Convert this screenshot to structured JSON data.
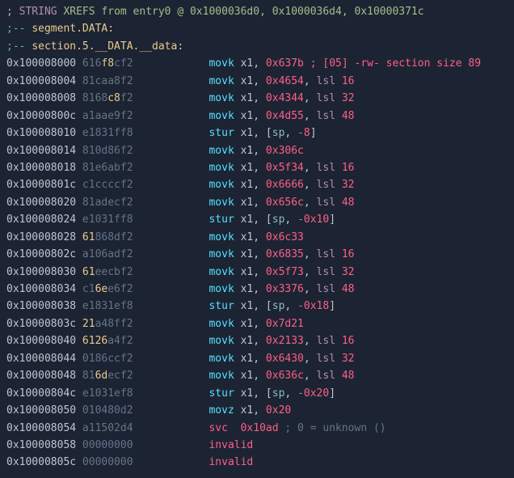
{
  "header": {
    "prefix": ";",
    "xrefs_kw": "STRING",
    "xrefs_rest": "XREFS from entry0 @ 0x1000036d0, 0x1000036d4, 0x10000371c",
    "seg_prefix": ";-- ",
    "seg": "segment.DATA:",
    "sec": "section.5.__DATA.__data:"
  },
  "col_widths": {
    "addr": 11,
    "hex": 8,
    "gap1": 12,
    "mnem": 5
  },
  "rows": [
    {
      "addr": "0x100008000",
      "hl": [
        3,
        4
      ],
      "hex": "616f8cf2",
      "mnem": "movk",
      "r": "x1",
      "imm": "0x637b",
      "extra_comment": "; [05] -rw- section size 89"
    },
    {
      "addr": "0x100008004",
      "hex": "81caa8f2",
      "mnem": "movk",
      "r": "x1",
      "imm": "0x4654",
      "lsl": "16"
    },
    {
      "addr": "0x100008008",
      "hl": [
        4,
        5
      ],
      "hex": "8168c8f2",
      "mnem": "movk",
      "r": "x1",
      "imm": "0x4344",
      "lsl": "32"
    },
    {
      "addr": "0x10000800c",
      "hex": "a1aae9f2",
      "mnem": "movk",
      "r": "x1",
      "imm": "0x4d55",
      "lsl": "48"
    },
    {
      "addr": "0x100008010",
      "hex": "e1831ff8",
      "mnem": "stur",
      "r": "x1",
      "mem": true,
      "offs": "-8"
    },
    {
      "addr": "0x100008014",
      "hex": "810d86f2",
      "mnem": "movk",
      "r": "x1",
      "imm": "0x306c"
    },
    {
      "addr": "0x100008018",
      "hex": "81e6abf2",
      "mnem": "movk",
      "r": "x1",
      "imm": "0x5f34",
      "lsl": "16"
    },
    {
      "addr": "0x10000801c",
      "hex": "c1ccccf2",
      "mnem": "movk",
      "r": "x1",
      "imm": "0x6666",
      "lsl": "32"
    },
    {
      "addr": "0x100008020",
      "hex": "81adecf2",
      "mnem": "movk",
      "r": "x1",
      "imm": "0x656c",
      "lsl": "48"
    },
    {
      "addr": "0x100008024",
      "hex": "e1031ff8",
      "mnem": "stur",
      "r": "x1",
      "mem": true,
      "offs": "-0x10"
    },
    {
      "addr": "0x100008028",
      "hl": [
        0,
        1
      ],
      "hex": "61868df2",
      "mnem": "movk",
      "r": "x1",
      "imm": "0x6c33"
    },
    {
      "addr": "0x10000802c",
      "hex": "a106adf2",
      "mnem": "movk",
      "r": "x1",
      "imm": "0x6835",
      "lsl": "16"
    },
    {
      "addr": "0x100008030",
      "hl": [
        0,
        1
      ],
      "hex": "61eecbf2",
      "mnem": "movk",
      "r": "x1",
      "imm": "0x5f73",
      "lsl": "32"
    },
    {
      "addr": "0x100008034",
      "hl": [
        2,
        3
      ],
      "hex": "c16ee6f2",
      "mnem": "movk",
      "r": "x1",
      "imm": "0x3376",
      "lsl": "48"
    },
    {
      "addr": "0x100008038",
      "hex": "e1831ef8",
      "mnem": "stur",
      "r": "x1",
      "mem": true,
      "offs": "-0x18"
    },
    {
      "addr": "0x10000803c",
      "hl": [
        0,
        1
      ],
      "hex": "21a48ff2",
      "mnem": "movk",
      "r": "x1",
      "imm": "0x7d21"
    },
    {
      "addr": "0x100008040",
      "hl": [
        0,
        3
      ],
      "hex": "6126a4f2",
      "mnem": "movk",
      "r": "x1",
      "imm": "0x2133",
      "lsl": "16"
    },
    {
      "addr": "0x100008044",
      "hex": "0186ccf2",
      "mnem": "movk",
      "r": "x1",
      "imm": "0x6430",
      "lsl": "32"
    },
    {
      "addr": "0x100008048",
      "hl": [
        2,
        3
      ],
      "hex": "816decf2",
      "mnem": "movk",
      "r": "x1",
      "imm": "0x636c",
      "lsl": "48"
    },
    {
      "addr": "0x10000804c",
      "hex": "e1031ef8",
      "mnem": "stur",
      "r": "x1",
      "mem": true,
      "offs": "-0x20"
    },
    {
      "addr": "0x100008050",
      "hex": "010480d2",
      "mnem": "movz",
      "r": "x1",
      "imm": "0x20"
    },
    {
      "addr": "0x100008054",
      "hex": "a11502d4",
      "mnem": "svc",
      "svc_imm": "0x10ad",
      "svc_cmt": "; 0 = unknown ()"
    },
    {
      "addr": "0x100008058",
      "hex": "00000000",
      "invalid": true
    },
    {
      "addr": "0x10000805c",
      "hex": "00000000",
      "invalid": true
    }
  ],
  "tok": {
    "lsl": "lsl",
    "sp": "sp",
    "invalid": "invalid"
  }
}
